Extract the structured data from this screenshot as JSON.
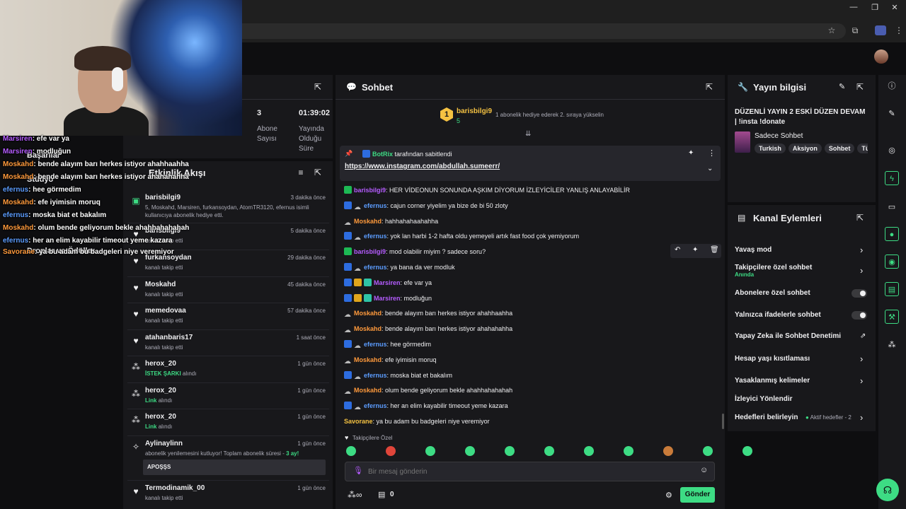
{
  "browser": {
    "controls": [
      "—",
      "❐",
      "✕"
    ]
  },
  "overlay_chat": [
    {
      "user": "Marsiren",
      "text": ": efe var ya",
      "color": "#b55cff"
    },
    {
      "user": "Marsiren",
      "text": ": modluğun",
      "color": "#b55cff"
    },
    {
      "user": "Moskahd",
      "text": ": bende alayım barı herkes istiyor ahahhaahha",
      "color": "#ff9a3c"
    },
    {
      "user": "Moskahd",
      "text": ": bende alayım barı herkes istiyor ahahahahha",
      "color": "#ff9a3c"
    },
    {
      "user": "efernus",
      "text": ": hee görmedim",
      "color": "#5c9dff"
    },
    {
      "user": "Moskahd",
      "text": ": efe iyimisin moruq",
      "color": "#ff9a3c"
    },
    {
      "user": "efernus",
      "text": ": moska biat et bakalım",
      "color": "#5c9dff"
    },
    {
      "user": "Moskahd",
      "text": ": olum bende geliyorum bekle ahahhahahahah",
      "color": "#ff9a3c"
    },
    {
      "user": "efernus",
      "text": ": her an elim kayabilir timeout yeme kazara",
      "color": "#5c9dff"
    },
    {
      "user": "Savorane",
      "text": ": ya bu adam bu badgeleri niye veremiyor",
      "color": "#ff9a3c"
    }
  ],
  "left_nav": {
    "basarilar": "Başarılar",
    "studyo": "Stüdyo",
    "droplar": "Droplar ve Ödüller"
  },
  "stats": [
    {
      "value": "3",
      "label": "Abone Sayısı"
    },
    {
      "value": "01:39:02",
      "label": "Yayında Olduğu Süre"
    }
  ],
  "activity": {
    "title": "Etkinlik Akışı",
    "items": [
      {
        "name": "barisbilgi9",
        "time": "3 dakika önce",
        "sub": "5, Moskahd, Marsiren, furkansoydan, AtomTR3120, efernus isimli kullanıcıya abonelik hediye etti.",
        "icon": "gift-icon",
        "glyph": "▣"
      },
      {
        "name": "barisbilgi9",
        "time": "5 dakika önce",
        "sub": "kanalı takip etti",
        "icon": "heart-icon",
        "glyph": "♥"
      },
      {
        "name": "furkansoydan",
        "time": "29 dakika önce",
        "sub": "kanalı takip etti",
        "icon": "heart-icon",
        "glyph": "♥"
      },
      {
        "name": "Moskahd",
        "time": "45 dakika önce",
        "sub": "kanalı takip etti",
        "icon": "heart-icon",
        "glyph": "♥"
      },
      {
        "name": "memedovaa",
        "time": "57 dakika önce",
        "sub": "kanalı takip etti",
        "icon": "heart-icon",
        "glyph": "♥"
      },
      {
        "name": "atahanbaris17",
        "time": "1 saat önce",
        "sub": "kanalı takip etti",
        "icon": "heart-icon",
        "glyph": "♥"
      },
      {
        "name": "herox_20",
        "time": "1 gün önce",
        "sub_hl": "İSTEK ŞARKI",
        "sub": "alındı",
        "icon": "points-icon",
        "glyph": "⁂"
      },
      {
        "name": "herox_20",
        "time": "1 gün önce",
        "sub_hl": "Link",
        "sub": "alındı",
        "icon": "points-icon",
        "glyph": "⁂"
      },
      {
        "name": "herox_20",
        "time": "1 gün önce",
        "sub_hl": "Link",
        "sub": "alındı",
        "icon": "points-icon",
        "glyph": "⁂"
      }
    ],
    "resub": {
      "name": "Aylinaylinn",
      "time": "1 gün önce",
      "text": "abonelik yenilemesini kutluyor! Toplam abonelik süresi - ",
      "months": "3 ay!",
      "message": "APOŞŞS"
    },
    "last": {
      "name": "Termodinamik_00",
      "time": "1 gün önce",
      "sub": "kanalı takip etti"
    }
  },
  "chat": {
    "title": "Sohbet",
    "gifter": {
      "rank": "1",
      "name": "barisbilgi9",
      "count": "5",
      "text": "1 aboneli​k hediye ederek 2. sıraya yükselin"
    },
    "pinned": {
      "by": "BotRix",
      "by_text": "tarafından sabitlendi",
      "link": "https://www.instagram.com/abdullah.sumeerr/"
    },
    "messages": [
      {
        "user": "barisbilgi9",
        "cls": "u-purple",
        "badges": [
          "b-green"
        ],
        "text": ": HER VİDEONUN SONUNDA AŞKIM DİYORUM İZLEYİCİLER YANLIŞ ANLAYABİLİR"
      },
      {
        "user": "efernus",
        "cls": "u-blue",
        "badges": [
          "b-blue",
          "b-grey"
        ],
        "text": ": cajun corner yiyelim ya bize de bi 50 zloty"
      },
      {
        "user": "Moskahd",
        "cls": "u-orange",
        "badges": [
          "b-grey"
        ],
        "text": ": hahhahahaahahha"
      },
      {
        "user": "efernus",
        "cls": "u-blue",
        "badges": [
          "b-blue",
          "b-grey"
        ],
        "text": ": yok lan harbi 1-2 hafta oldu yemeyeli artık fast food çok yemiyorum"
      },
      {
        "user": "barisbilgi9",
        "cls": "u-purple",
        "badges": [
          "b-green"
        ],
        "text": ": mod olabilir miyim ? sadece soru?"
      },
      {
        "user": "efernus",
        "cls": "u-blue",
        "badges": [
          "b-blue",
          "b-grey"
        ],
        "text": ": ya bana da ver modluk"
      },
      {
        "user": "Marsiren",
        "cls": "u-purple",
        "badges": [
          "b-blue",
          "b-gold",
          "b-teal"
        ],
        "text": ": efe var ya"
      },
      {
        "user": "Marsiren",
        "cls": "u-purple",
        "badges": [
          "b-blue",
          "b-gold",
          "b-teal"
        ],
        "text": ": modluğun"
      },
      {
        "user": "Moskahd",
        "cls": "u-orange",
        "badges": [
          "b-grey"
        ],
        "text": ": bende alayım barı herkes istiyor ahahhaahha"
      },
      {
        "user": "Moskahd",
        "cls": "u-orange",
        "badges": [
          "b-grey"
        ],
        "text": ": bende alayım barı herkes istiyor ahahahahha"
      },
      {
        "user": "efernus",
        "cls": "u-blue",
        "badges": [
          "b-blue",
          "b-grey"
        ],
        "text": ": hee görmedim"
      },
      {
        "user": "Moskahd",
        "cls": "u-orange",
        "badges": [
          "b-grey"
        ],
        "text": ": efe iyimisin moruq"
      },
      {
        "user": "efernus",
        "cls": "u-blue",
        "badges": [
          "b-blue",
          "b-grey"
        ],
        "text": ": moska biat et bakalım"
      },
      {
        "user": "Moskahd",
        "cls": "u-orange",
        "badges": [
          "b-grey"
        ],
        "text": ": olum bende geliyorum bekle ahahhahahahah"
      },
      {
        "user": "efernus",
        "cls": "u-blue",
        "badges": [
          "b-blue",
          "b-grey"
        ],
        "text": ": her an elim kayabilir timeout yeme kazara"
      },
      {
        "user": "Savorane",
        "cls": "u-gold",
        "badges": [],
        "text": ": ya bu adam bu badgeleri niye veremiyor"
      }
    ],
    "emote_label": "Takipçilere Özel",
    "input_placeholder": "Bir mesaj gönderin",
    "points": "0",
    "send": "Gönder"
  },
  "stream_info": {
    "title": "Yayın bilgisi",
    "stream_title": "DÜZENLİ YAYIN 2 ESKİ DÜZEN DEVAM | !insta !donate",
    "category": "Sadece Sohbet",
    "tags": [
      "Turkish",
      "Aksiyon",
      "Sohbet",
      "Tü"
    ]
  },
  "channel_actions": {
    "title": "Kanal Eylemleri",
    "rows": [
      {
        "label": "Yavaş mod",
        "control": "chevron"
      },
      {
        "label": "Takipçilere özel sohbet",
        "sub": "Anında",
        "control": "chevron"
      },
      {
        "label": "Abonelere özel sohbet",
        "control": "toggle"
      },
      {
        "label": "Yalnızca ifadelerle sohbet",
        "control": "toggle"
      },
      {
        "label": "Yapay Zeka ile Sohbet Denetimi",
        "control": "external"
      },
      {
        "label": "Hesap yaşı kısıtlaması",
        "control": "chevron"
      },
      {
        "label": "Yasaklanmış kelimeler",
        "control": "chevron"
      },
      {
        "label": "İzleyici Yönlendir",
        "control": "none"
      },
      {
        "label": "Hedefleri belirleyin",
        "sub_right": "Aktif hedefler - 2",
        "control": "chevron"
      }
    ]
  }
}
